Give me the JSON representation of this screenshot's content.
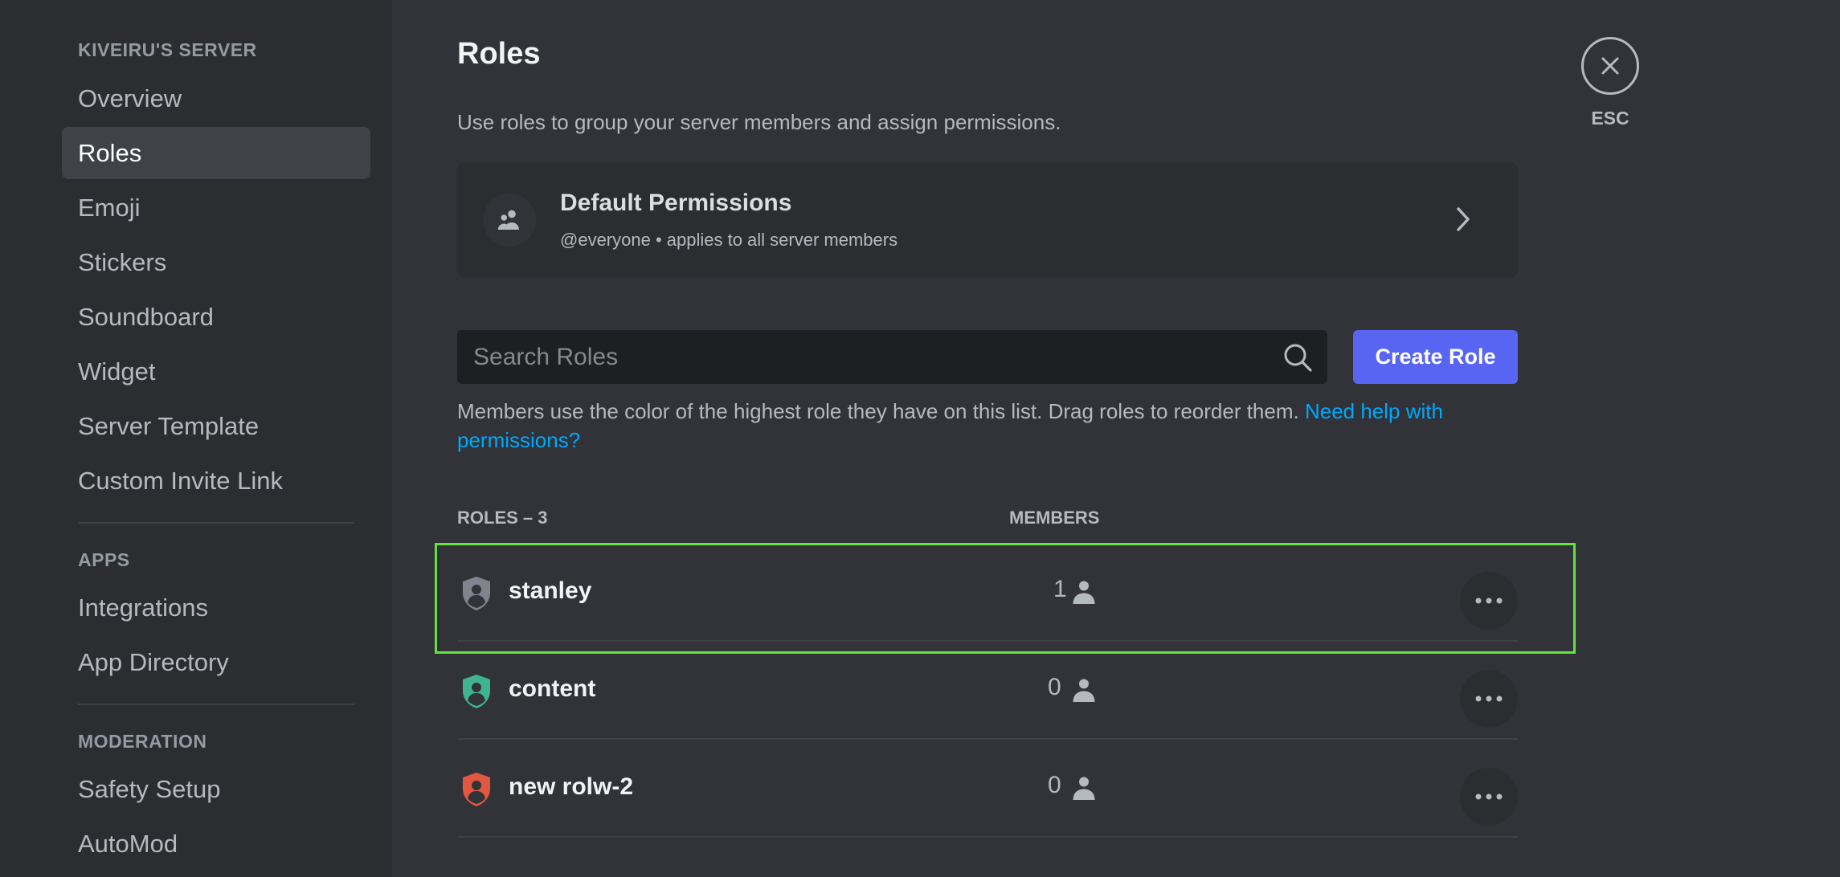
{
  "sidebar": {
    "server_header": "KIVEIRU'S SERVER",
    "server_items": [
      "Overview",
      "Roles",
      "Emoji",
      "Stickers",
      "Soundboard",
      "Widget",
      "Server Template",
      "Custom Invite Link"
    ],
    "selected": "Roles",
    "apps_header": "APPS",
    "apps_items": [
      "Integrations",
      "App Directory"
    ],
    "moderation_header": "MODERATION",
    "moderation_items": [
      "Safety Setup",
      "AutoMod"
    ]
  },
  "main": {
    "title": "Roles",
    "description": "Use roles to group your server members and assign permissions.",
    "default_permissions": {
      "title": "Default Permissions",
      "subtitle": "@everyone • applies to all server members",
      "icon": "members-icon"
    },
    "search": {
      "placeholder": "Search Roles",
      "value": ""
    },
    "create_role_label": "Create Role",
    "help_text": "Members use the color of the highest role they have on this list. Drag roles to reorder them. ",
    "help_link": "Need help with permissions?",
    "roles_header": "ROLES – 3",
    "members_header": "MEMBERS",
    "roles": [
      {
        "name": "stanley",
        "members": "1",
        "color": "#80848e"
      },
      {
        "name": "content",
        "members": "0",
        "color": "#3fb58f"
      },
      {
        "name": "new rolw-2",
        "members": "0",
        "color": "#e2573f"
      }
    ]
  },
  "close": {
    "label": "ESC",
    "icon": "close-icon"
  },
  "colors": {
    "accent": "#5865f2",
    "link": "#00a8fc",
    "highlight": "#62e33f"
  }
}
